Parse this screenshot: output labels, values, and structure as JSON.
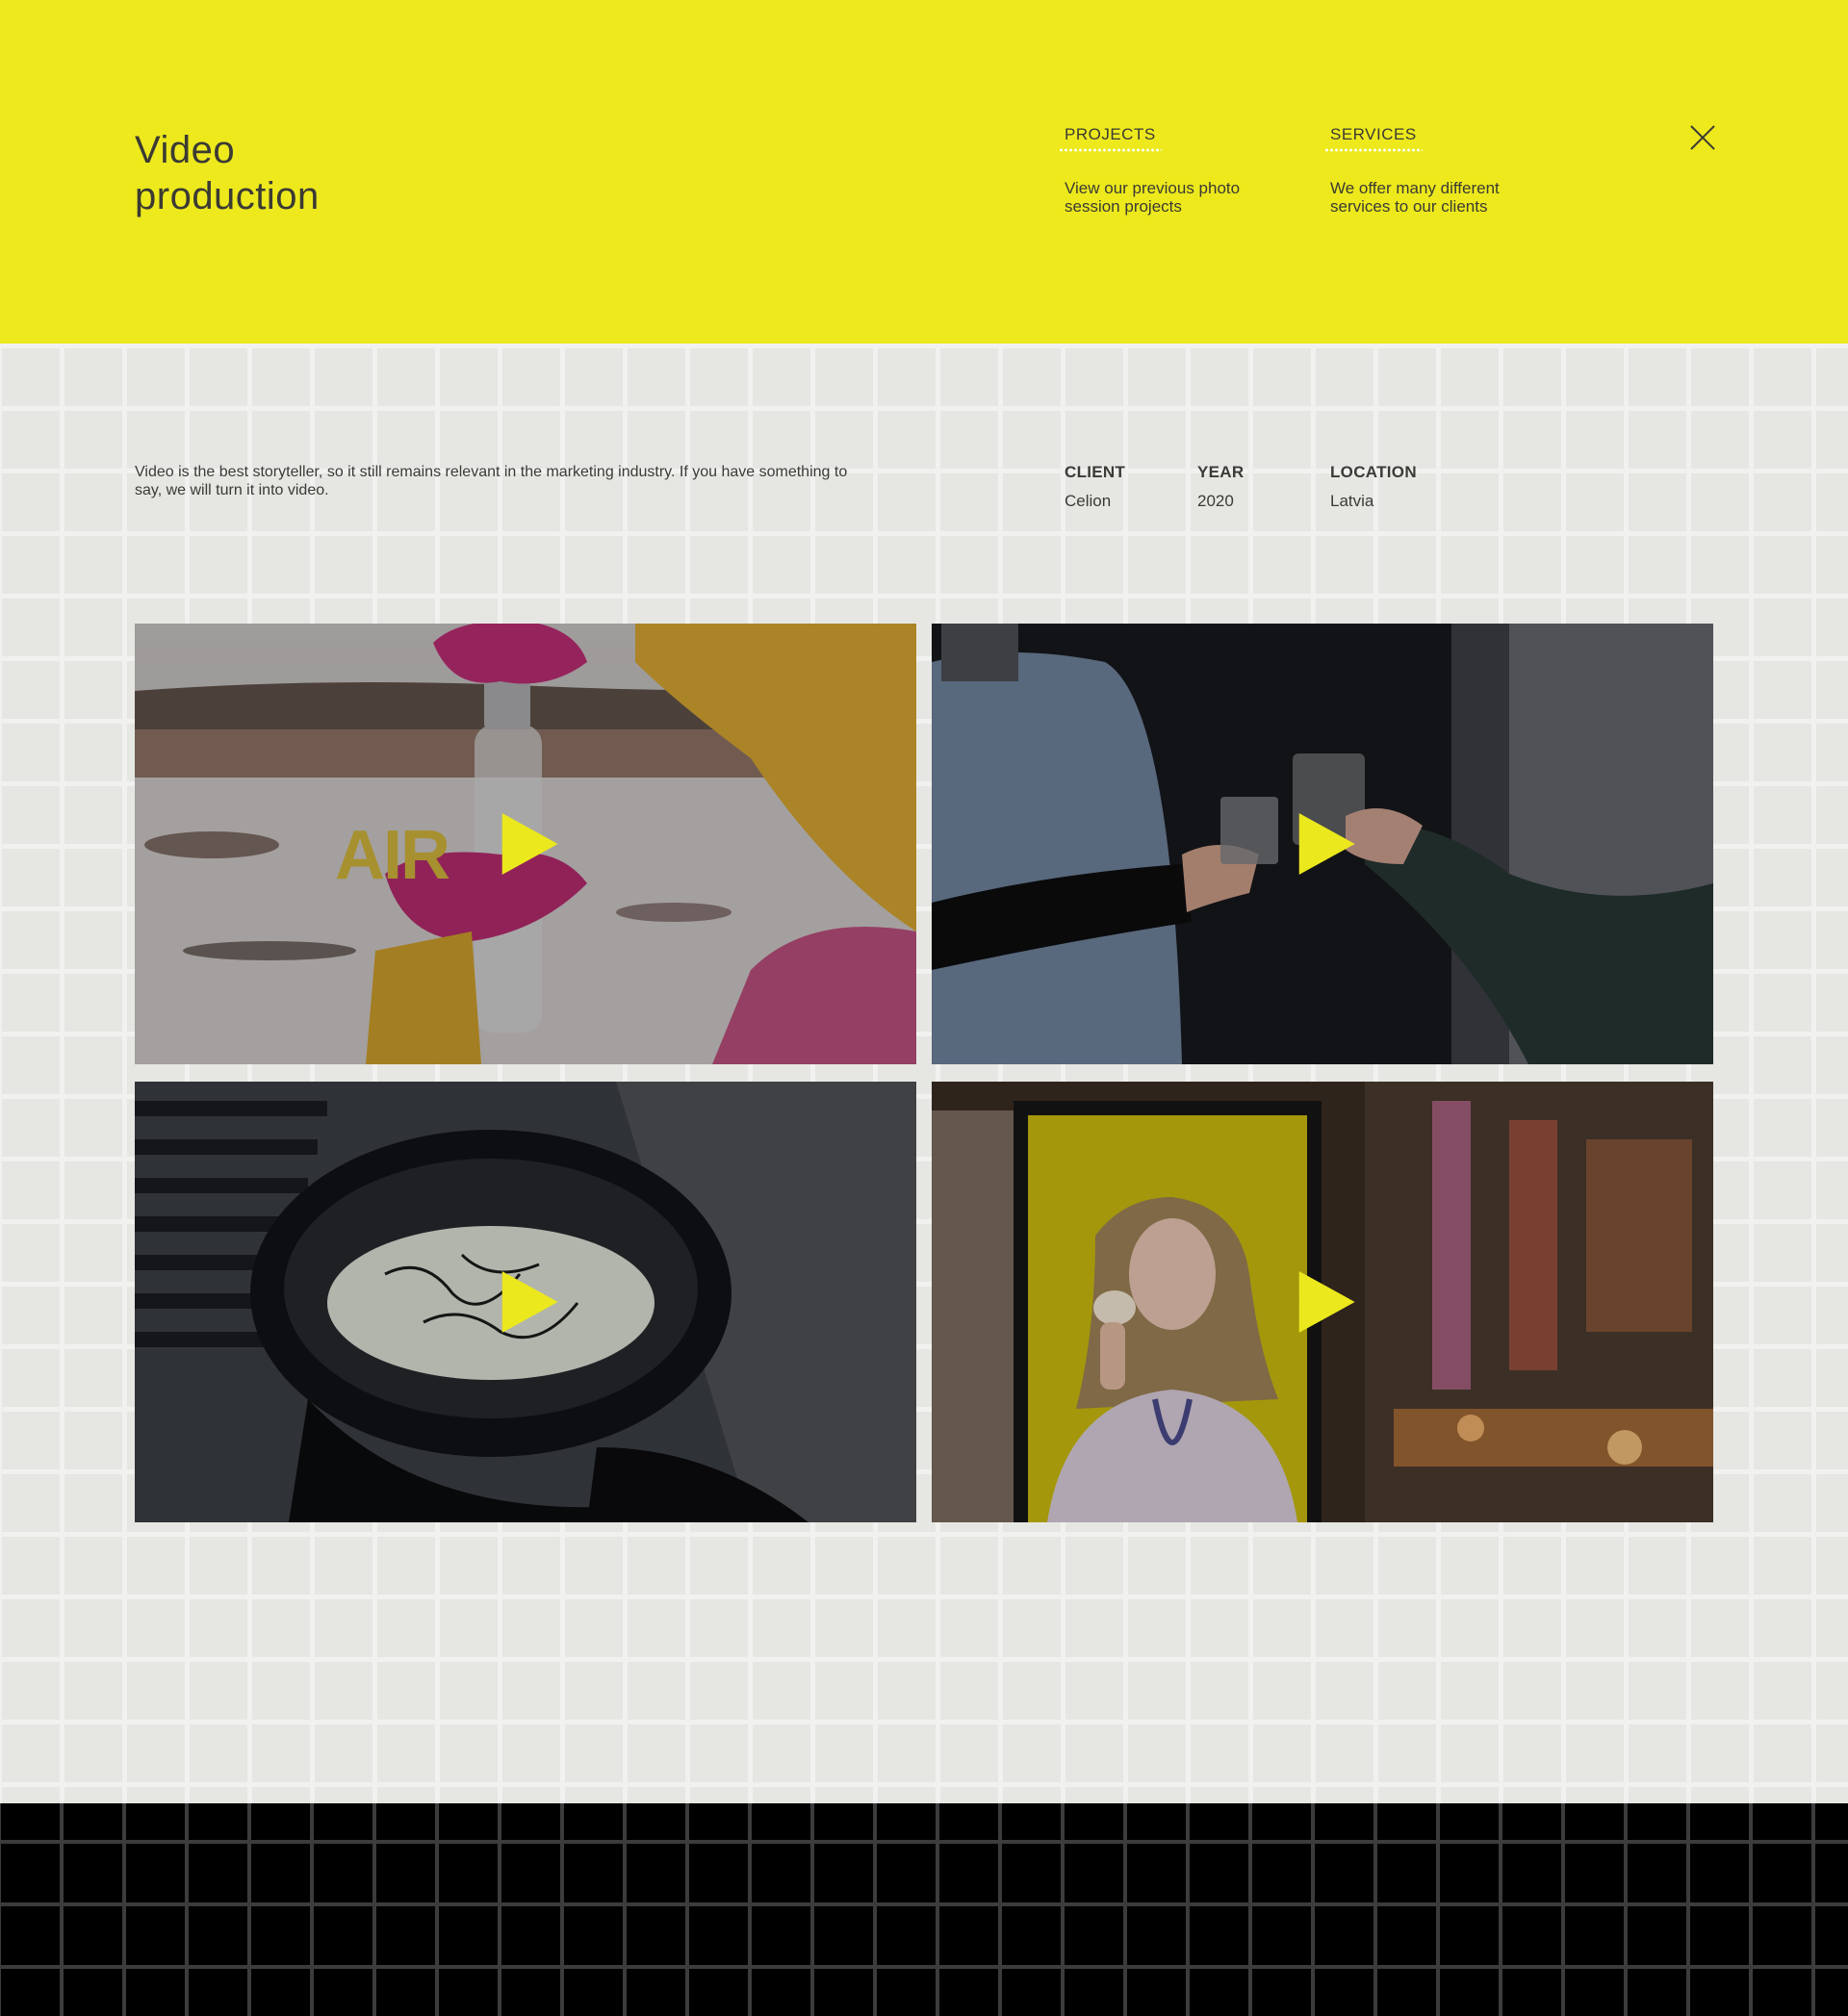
{
  "header": {
    "title_line1": "Video",
    "title_line2": "production",
    "nav": [
      {
        "label": "PROJECTS",
        "description": "View our previous photo session projects"
      },
      {
        "label": "SERVICES",
        "description": "We offer many different services to our clients"
      }
    ],
    "close_icon": "close-icon"
  },
  "project": {
    "description": "Video is the best storyteller, so it still remains relevant in the marketing industry. If you have something to say, we will turn it into video.",
    "meta": [
      {
        "label": "CLIENT",
        "value": "Celion"
      },
      {
        "label": "YEAR",
        "value": "2020"
      },
      {
        "label": "LOCATION",
        "value": "Latvia"
      }
    ]
  },
  "videos": [
    {
      "id": 1,
      "overlay_text": "AIR",
      "icon": "play-icon"
    },
    {
      "id": 2,
      "icon": "play-icon"
    },
    {
      "id": 3,
      "icon": "play-icon"
    },
    {
      "id": 4,
      "icon": "play-icon"
    }
  ],
  "colors": {
    "accent_yellow": "#ede91d",
    "play_yellow": "#ebe81d",
    "page_bg": "#e6e7e3",
    "grid_line": "#f1f2ef",
    "footer_bg": "#000000",
    "footer_grid": "#3c3c3c",
    "text": "#3a3a36"
  }
}
